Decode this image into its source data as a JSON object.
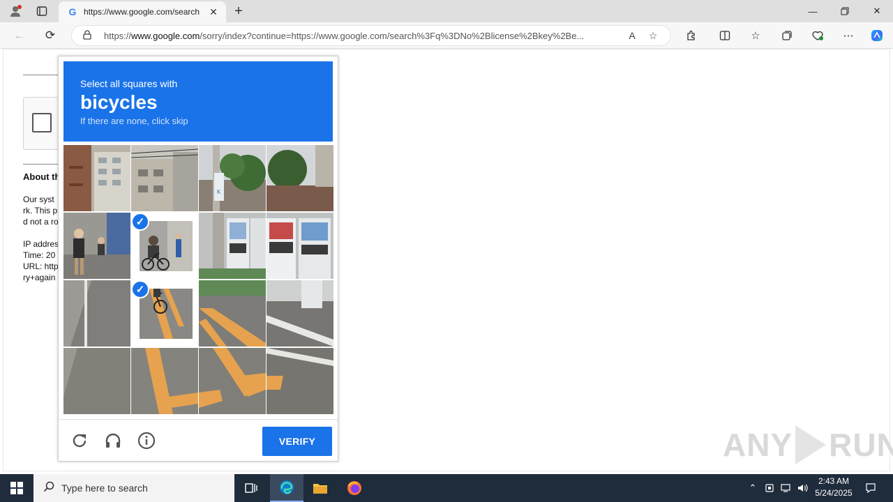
{
  "browser": {
    "tab_title": "https://www.google.com/search",
    "tab_favicon": "G",
    "new_tab_icon": "+",
    "address_prefix": "https://",
    "address_domain": "www.google.com",
    "address_rest": "/sorry/index?continue=https://www.google.com/search%3Fq%3DNo%2Blicense%2Bkey%2Be...",
    "colors": {
      "tabbar": "#dfdfdf",
      "toolbar": "#f7f7f7"
    }
  },
  "background_page": {
    "about_heading": "About th",
    "lines1": [
      "Our syst",
      "rk. This p",
      "d not a ro"
    ],
    "lines2": [
      "IP addres",
      "Time: 20",
      "URL: http",
      "ry+again"
    ]
  },
  "captcha": {
    "lead": "Select all squares with",
    "object": "bicycles",
    "subtitle": "If there are none, click skip",
    "verify_label": "VERIFY",
    "selected_tiles": [
      5,
      9
    ],
    "colors": {
      "accent": "#1a73e8"
    }
  },
  "watermark": {
    "left": "ANY",
    "right": "RUN"
  },
  "taskbar": {
    "search_placeholder": "Type here to search",
    "time": "2:43 AM",
    "date": "5/24/2025"
  }
}
